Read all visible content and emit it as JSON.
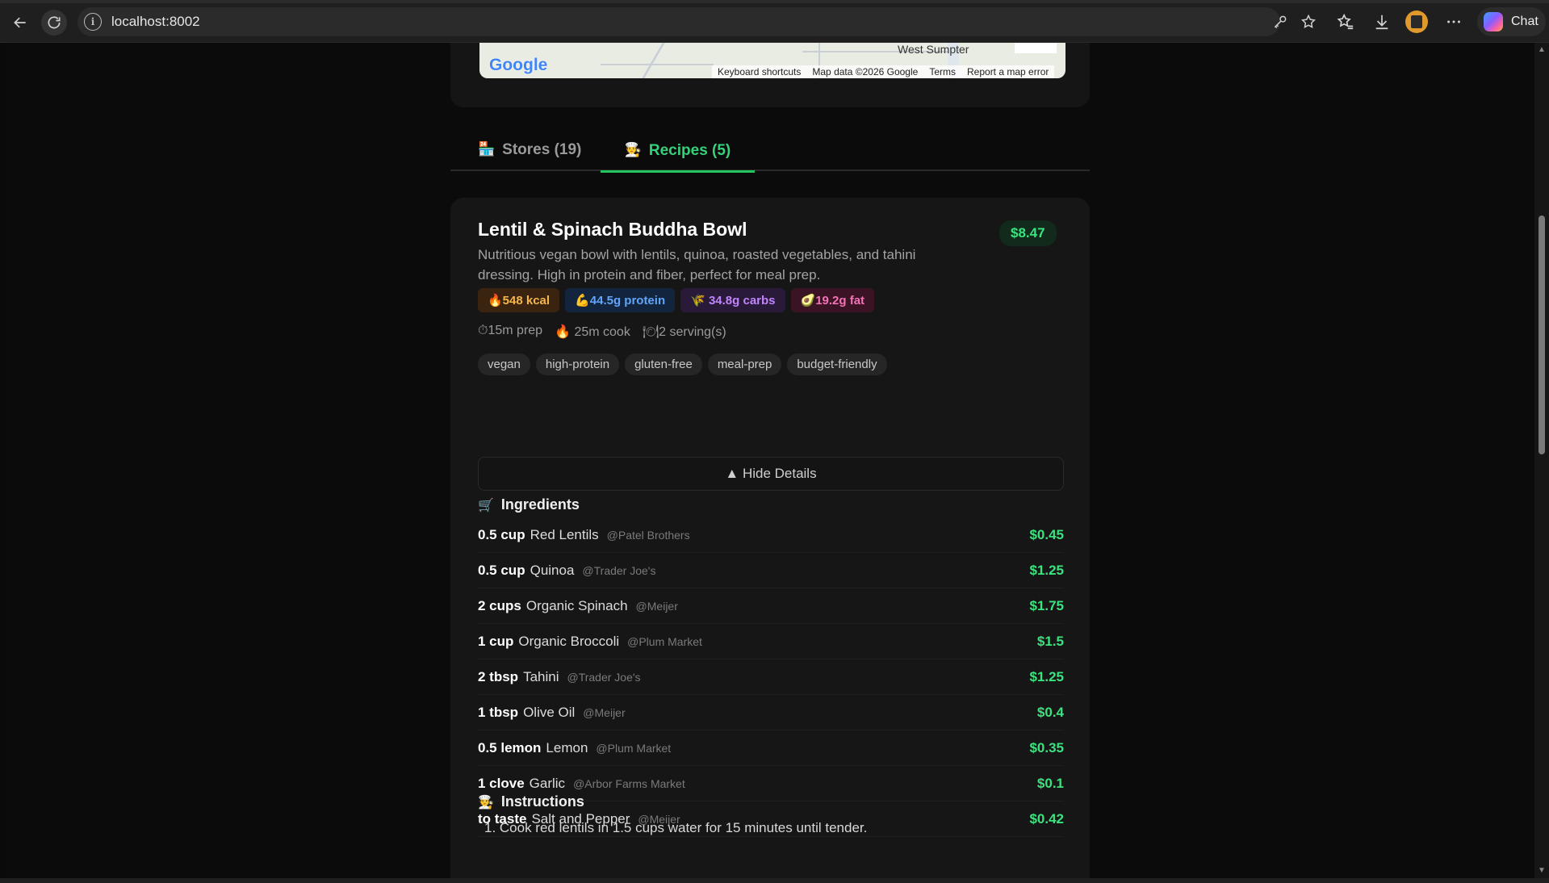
{
  "browser": {
    "url": "localhost:8002",
    "chat_label": "Chat"
  },
  "map": {
    "place_label": "West Sumpter",
    "google_logo": "Google",
    "attribution": [
      "Keyboard shortcuts",
      "Map data ©2026 Google",
      "Terms",
      "Report a map error"
    ]
  },
  "tabs": {
    "stores": {
      "icon": "🏪",
      "label": "Stores (19)"
    },
    "recipes": {
      "icon": "🧑‍🍳",
      "label": "Recipes (5)"
    }
  },
  "recipe": {
    "title": "Lentil & Spinach Buddha Bowl",
    "price": "$8.47",
    "description": "Nutritious vegan bowl with lentils, quinoa, roasted vegetables, and tahini dressing. High in protein and fiber, perfect for meal prep.",
    "macros": {
      "kcal": "🔥548 kcal",
      "protein": "💪44.5g protein",
      "carbs": "🌾 34.8g carbs",
      "fat": "🥑19.2g fat"
    },
    "times": {
      "prep": "⏱15m prep",
      "cook": "🔥 25m cook",
      "servings": "🍽2 serving(s)"
    },
    "tags": [
      "vegan",
      "high-protein",
      "gluten-free",
      "meal-prep",
      "budget-friendly"
    ],
    "toggle_label": "▲ Hide Details",
    "ingredients_heading": {
      "icon": "🛒",
      "label": "Ingredients"
    },
    "ingredients": [
      {
        "qty": "0.5 cup",
        "name": "Red Lentils",
        "store": "@Patel Brothers",
        "cost": "$0.45"
      },
      {
        "qty": "0.5 cup",
        "name": "Quinoa",
        "store": "@Trader Joe's",
        "cost": "$1.25"
      },
      {
        "qty": "2 cups",
        "name": "Organic Spinach",
        "store": "@Meijer",
        "cost": "$1.75"
      },
      {
        "qty": "1 cup",
        "name": "Organic Broccoli",
        "store": "@Plum Market",
        "cost": "$1.5"
      },
      {
        "qty": "2 tbsp",
        "name": "Tahini",
        "store": "@Trader Joe's",
        "cost": "$1.25"
      },
      {
        "qty": "1 tbsp",
        "name": "Olive Oil",
        "store": "@Meijer",
        "cost": "$0.4"
      },
      {
        "qty": "0.5 lemon",
        "name": "Lemon",
        "store": "@Plum Market",
        "cost": "$0.35"
      },
      {
        "qty": "1 clove",
        "name": "Garlic",
        "store": "@Arbor Farms Market",
        "cost": "$0.1"
      },
      {
        "qty": "to taste",
        "name": "Salt and Pepper",
        "store": "@Meijer",
        "cost": "$0.42"
      }
    ],
    "instructions_heading": {
      "icon": "🧑‍🍳",
      "label": "Instructions"
    },
    "instructions": [
      "1. Cook red lentils in 1.5 cups water for 15 minutes until tender."
    ]
  },
  "colors": {
    "accent_green": "#22c55e",
    "background": "#0b0b0b",
    "card": "#161616"
  }
}
